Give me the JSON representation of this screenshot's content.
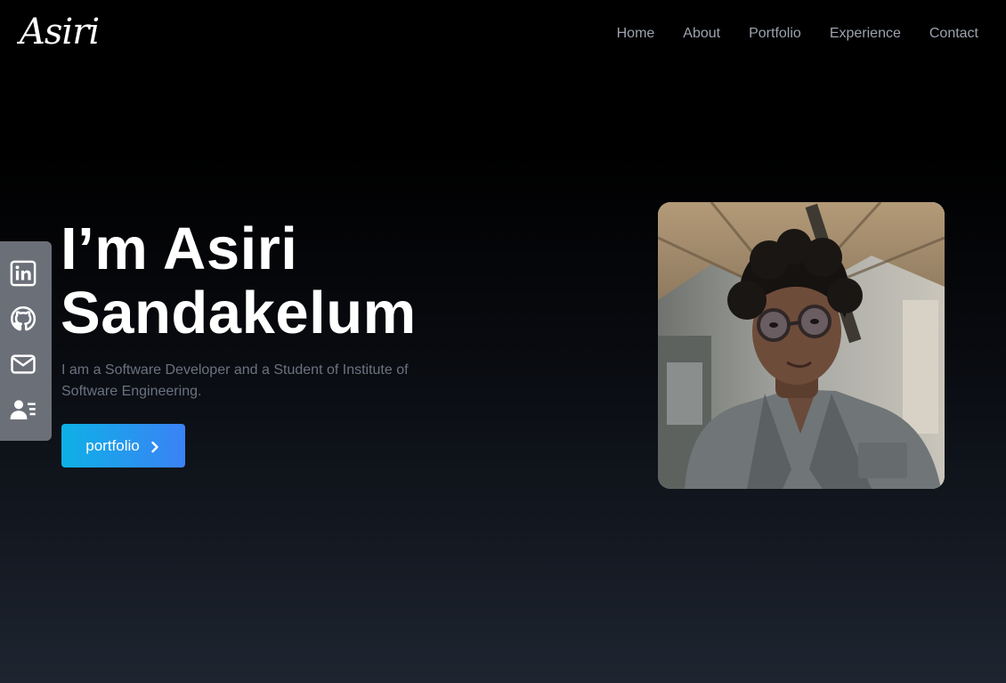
{
  "brand": {
    "logo_text": "Asiri"
  },
  "nav": {
    "items": [
      {
        "label": "Home"
      },
      {
        "label": "About"
      },
      {
        "label": "Portfolio"
      },
      {
        "label": "Experience"
      },
      {
        "label": "Contact"
      }
    ]
  },
  "social": {
    "icons": [
      "linkedin-icon",
      "github-icon",
      "mail-icon",
      "contact-card-icon"
    ]
  },
  "hero": {
    "title_line1": "I’m Asiri",
    "title_line2": "Sandakelum",
    "subtitle": "I am a Software Developer and a Student of Institute of Software Engineering.",
    "cta_label": "portfolio",
    "cta_icon": "chevron-right-icon"
  },
  "colors": {
    "background_top": "#000000",
    "background_bottom": "#1e2530",
    "nav_text": "#9ca3af",
    "subtitle_text": "#6b7280",
    "social_bar": "#6b6f78",
    "cta_gradient_start": "#0eb0e6",
    "cta_gradient_end": "#3b82f6"
  }
}
